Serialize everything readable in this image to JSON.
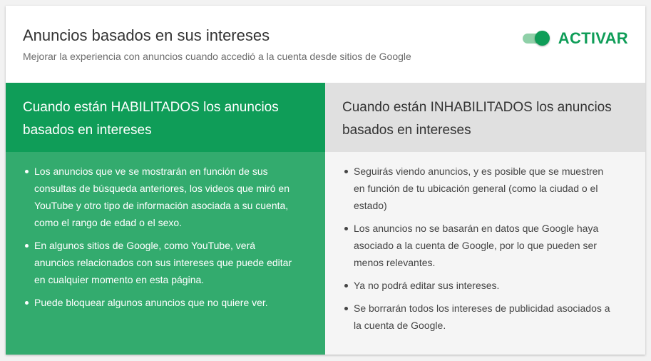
{
  "header": {
    "title": "Anuncios basados en sus intereses",
    "subtitle": "Mejorar la experiencia con anuncios cuando accedió a la cuenta desde sitios de Google",
    "toggle": {
      "label": "ACTIVAR",
      "state": "on"
    }
  },
  "enabled": {
    "heading_line1": "Cuando están HABILITADOS los anuncios",
    "heading_line2": "basados en intereses",
    "items": [
      {
        "line1": "Los anuncios que ve se mostrarán en función de sus",
        "line2": "consultas de búsqueda anteriores, los videos que miró en",
        "line3": "YouTube y otro tipo de información asociada a su cuenta,",
        "line4": "como el rango de edad o el sexo."
      },
      {
        "line1": "En algunos sitios de Google, como YouTube, verá",
        "line2": "anuncios relacionados con sus intereses que puede editar",
        "line3": "en cualquier momento en esta página."
      },
      {
        "line1": "Puede bloquear algunos anuncios que no quiere ver."
      }
    ]
  },
  "disabled": {
    "heading_line1": "Cuando están INHABILITADOS los anuncios",
    "heading_line2": "basados en intereses",
    "items": [
      {
        "line1": "Seguirás viendo anuncios, y es posible que se muestren",
        "line2": "en función de tu ubicación general (como la ciudad o el",
        "line3": "estado)"
      },
      {
        "line1": "Los anuncios no se basarán en datos que Google haya",
        "line2": "asociado a la cuenta de Google, por lo que pueden ser",
        "line3": "menos relevantes."
      },
      {
        "line1": "Ya no podrá editar sus intereses."
      },
      {
        "line1": "Se borrarán todos los intereses de publicidad asociados a",
        "line2": "la cuenta de Google."
      }
    ]
  },
  "colors": {
    "accent": "#0f9d58",
    "enabled_body": "#33ab6e",
    "disabled_head": "#e0e0e0",
    "disabled_body": "#f5f5f5"
  }
}
